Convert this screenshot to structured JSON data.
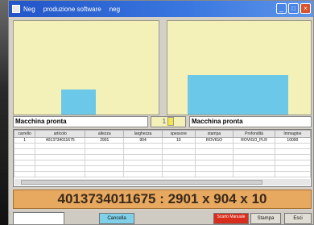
{
  "window": {
    "title": "Neg",
    "subtitle": "produzione software",
    "extra": "neg",
    "controls": [
      "_",
      "□",
      "×"
    ]
  },
  "panels": {
    "left": {
      "fill_fraction": 0.27,
      "bar_width_fraction": 0.24
    },
    "right": {
      "fill_fraction": 0.42,
      "bar_width_fraction": 0.7
    }
  },
  "status": {
    "left": "Macchina pronta",
    "right": "Macchina pronta",
    "spinner_value": "1"
  },
  "table": {
    "columns": [
      "carrello",
      "articolo",
      "altezza",
      "larghezza",
      "spessore",
      "stampa",
      "Profondità",
      "Immagine"
    ],
    "rows": [
      [
        "1",
        "4013734011675",
        "2901",
        "904",
        "10",
        "ROVIGO",
        "ROVIGO_PLR",
        "10000"
      ]
    ]
  },
  "display": {
    "text": "4013734011675 : 2901 x 904 x 10"
  },
  "buttons": {
    "cancel": "Cancella",
    "red": "Scarto Manuale",
    "print": "Stampa",
    "exit": "Esci"
  },
  "colors": {
    "panel_bg": "#f4f1b8",
    "bar": "#6cc8e8",
    "display_bg": "#e7a860",
    "cancel": "#7fd0e8",
    "red_button": "#d82c1c"
  }
}
